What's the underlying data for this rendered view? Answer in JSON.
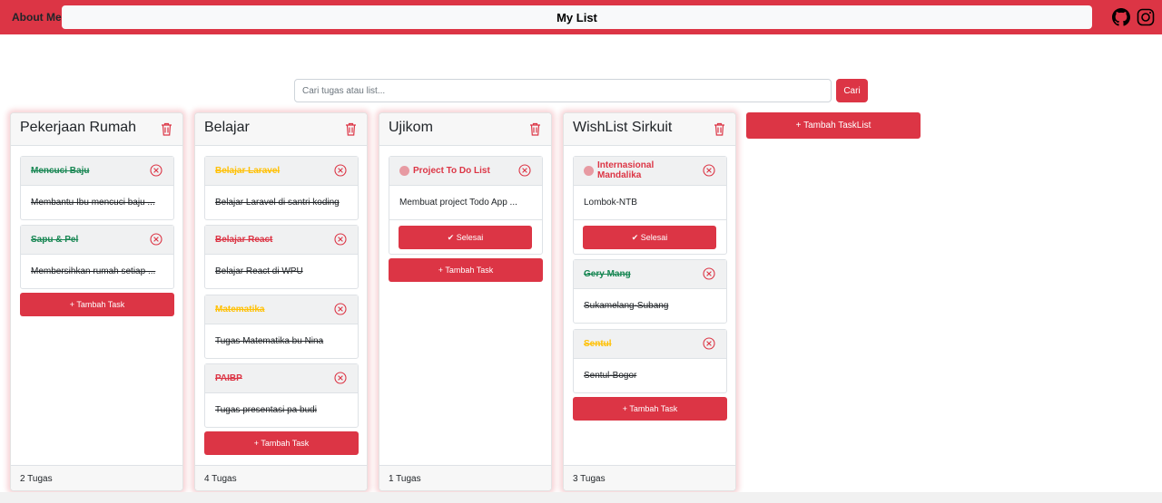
{
  "header": {
    "about": "About Me",
    "title": "My List",
    "icons": [
      "github-icon",
      "instagram-icon"
    ]
  },
  "search": {
    "placeholder": "Cari tugas atau list...",
    "value": "",
    "button": "Cari"
  },
  "add_tasklist": "+ Tambah TaskList",
  "add_task": "+ Tambah Task",
  "done_label": "✔ Selesai",
  "colors": {
    "accent": "#dc3545",
    "green": "#198754",
    "yellow": "#ffc107"
  },
  "columns": [
    {
      "title": "Pekerjaan Rumah",
      "footer": "2 Tugas",
      "tasks": [
        {
          "title": "Mencuci Baju",
          "body": "Membantu Ibu mencuci baju ...",
          "color": "green",
          "status": "done"
        },
        {
          "title": "Sapu & Pel",
          "body": "Membersihkan rumah setiap ...",
          "color": "green",
          "status": "done"
        }
      ]
    },
    {
      "title": "Belajar",
      "footer": "4 Tugas",
      "tasks": [
        {
          "title": "Belajar Laravel",
          "body": "Belajar Laravel di santri koding",
          "color": "yellow",
          "status": "done"
        },
        {
          "title": "Belajar React",
          "body": "Belajar React di WPU",
          "color": "red",
          "status": "done"
        },
        {
          "title": "Matematika",
          "body": "Tugas Matematika bu Nina",
          "color": "yellow",
          "status": "done"
        },
        {
          "title": "PAIBP",
          "body": "Tugas presentasi pa budi",
          "color": "red",
          "status": "done"
        }
      ]
    },
    {
      "title": "Ujikom",
      "footer": "1 Tugas",
      "tasks": [
        {
          "title": "Project To Do List",
          "body": "Membuat project Todo App ...",
          "color": "red",
          "status": "pending"
        }
      ]
    },
    {
      "title": "WishList Sirkuit",
      "footer": "3 Tugas",
      "tasks": [
        {
          "title": "Internasional Mandalika",
          "body": "Lombok-NTB",
          "color": "red",
          "status": "pending"
        },
        {
          "title": "Gery Mang",
          "body": "Sukamelang-Subang",
          "color": "green",
          "status": "done"
        },
        {
          "title": "Sentul",
          "body": "Sentul-Bogor",
          "color": "yellow",
          "status": "done"
        }
      ]
    }
  ]
}
